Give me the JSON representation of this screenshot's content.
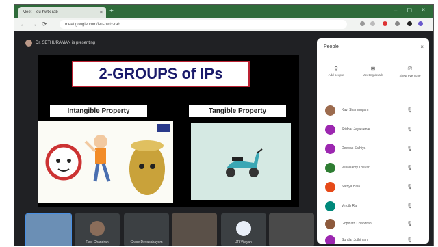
{
  "browser": {
    "tab_title": "Meet - ieu-hwtx-rab",
    "tab_close": "×",
    "new_tab": "+",
    "window_controls": "– ▢ ×",
    "url": "meet.google.com/ieu-hwtx-rab",
    "nav": {
      "back": "←",
      "forward": "→",
      "reload": "⟳"
    }
  },
  "meet": {
    "presenting_text": "Dr. SETHURAMAN is presenting",
    "slide": {
      "title": "2-GROUPS of IPs",
      "left_label": "Intangible Property",
      "right_label": "Tangible Property"
    },
    "filmstrip": [
      {
        "name": "",
        "color": "#6b8fb5"
      },
      {
        "name": "Ravi Chandran",
        "color": "#8a6d5a"
      },
      {
        "name": "Grace Devasahayam",
        "color": "#3c4043"
      },
      {
        "name": "",
        "color": "#5a5048"
      },
      {
        "name": "JR Vijayan",
        "color": "#3c4043"
      },
      {
        "name": "",
        "color": "#4a4a4a"
      }
    ]
  },
  "people": {
    "title": "People",
    "close": "×",
    "tabs": [
      {
        "icon": "⚲",
        "label": "Add people"
      },
      {
        "icon": "⊞",
        "label": "Meeting details"
      },
      {
        "icon": "⎚",
        "label": "Show everyone"
      }
    ],
    "participants": [
      {
        "name": "Kavi Shanmugam",
        "color": "#9c6b4e"
      },
      {
        "name": "Sridhar Jayakumar",
        "color": "#9c27b0"
      },
      {
        "name": "Deepak Sathiya",
        "color": "#9c27b0"
      },
      {
        "name": "Vellaisamy Thevar",
        "color": "#2e7d32"
      },
      {
        "name": "Sathya Bala",
        "color": "#e64a19"
      },
      {
        "name": "Vinoth Raj",
        "color": "#00897b"
      },
      {
        "name": "Gopinath Chandran",
        "color": "#8d5a3c"
      },
      {
        "name": "Sundar Jothimani",
        "color": "#9c27b0"
      }
    ],
    "mic_glyph": "🎙",
    "more_glyph": "⋮"
  }
}
